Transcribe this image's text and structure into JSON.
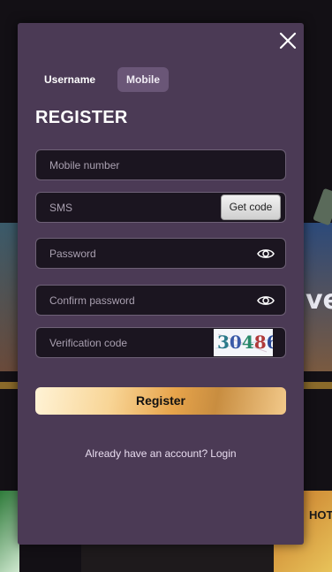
{
  "tabs": {
    "username": "Username",
    "mobile": "Mobile"
  },
  "title": "REGISTER",
  "fields": {
    "mobile_placeholder": "Mobile number",
    "sms_placeholder": "SMS",
    "get_code": "Get code",
    "password_placeholder": "Password",
    "confirm_placeholder": "Confirm password",
    "verification_placeholder": "Verification code",
    "captcha": [
      "3",
      "0",
      "4",
      "8",
      "6"
    ]
  },
  "register_button": "Register",
  "footer": {
    "prompt": "Already have an account?",
    "login": "Login"
  },
  "background": {
    "partial_word": "ve",
    "badge": "HOT"
  },
  "colors": {
    "modal_bg": "#4b3a55",
    "input_bg": "#1b1520",
    "accent_gold": "#e7a44b",
    "tab_active": "#6a5677"
  },
  "icons": {
    "close": "close-icon",
    "eye": "eye-icon"
  }
}
